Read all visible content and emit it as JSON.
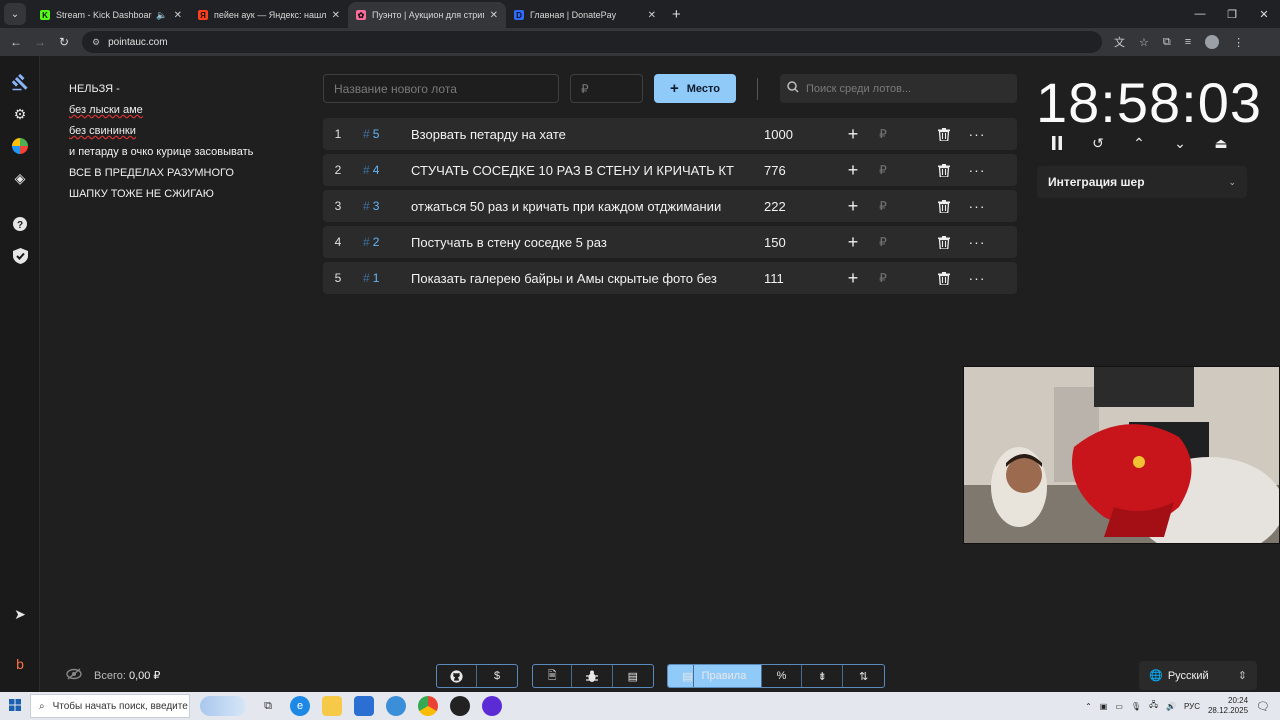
{
  "browser": {
    "tabs": [
      {
        "title": "Stream - Kick Dashboard",
        "icon": "kick-icon",
        "color": "#53fc18",
        "letter": "K",
        "active": false,
        "audio": true
      },
      {
        "title": "пейен аук — Яндекс: нашлось",
        "icon": "yandex-icon",
        "color": "#fc3f1d",
        "letter": "Я",
        "active": false,
        "audio": false
      },
      {
        "title": "Пуэнто | Аукцион для стриме...",
        "icon": "pointauc-icon",
        "color": "#ff6b9a",
        "letter": "✿",
        "active": true,
        "audio": false
      },
      {
        "title": "Главная | DonatePay",
        "icon": "donatepay-icon",
        "color": "#2f6bff",
        "letter": "D",
        "active": false,
        "audio": false
      }
    ],
    "url": "pointauc.com"
  },
  "rules": [
    "НЕЛЬЗЯ -",
    "без лыски аме",
    "без свининки",
    "и петарду в очко курице засовывать",
    "ВСЕ В ПРЕДЕЛАХ РАЗУМНОГО",
    "ШАПКУ ТОЖЕ НЕ СЖИГАЮ"
  ],
  "controls": {
    "lot_placeholder": "Название нового лота",
    "price_placeholder": "₽",
    "place_button": "Место",
    "search_placeholder": "Поиск среди лотов..."
  },
  "lots": [
    {
      "num": "1",
      "fast_id": "5",
      "name": "Взорвать петарду на хате",
      "amount": "1000"
    },
    {
      "num": "2",
      "fast_id": "4",
      "name": "СТУЧАТЬ СОСЕДКЕ 10 РАЗ В СТЕНУ И КРИЧАТЬ КТ",
      "amount": "776"
    },
    {
      "num": "3",
      "fast_id": "3",
      "name": "отжаться 50 раз и кричать при каждом отджимании",
      "amount": "222"
    },
    {
      "num": "4",
      "fast_id": "2",
      "name": "Постучать в стену соседке 5 раз",
      "amount": "150"
    },
    {
      "num": "5",
      "fast_id": "1",
      "name": "Показать галерею байры и Амы скрытые фото без",
      "amount": "111"
    }
  ],
  "lot_hash": "#",
  "rub_symbol": "₽",
  "timer": {
    "time": "18:58:03"
  },
  "integration": {
    "label": "Интеграция шер"
  },
  "footer": {
    "total_label": "Всего:",
    "total_value": "0,00 ₽",
    "rules_button": "Правила",
    "language": "Русский"
  },
  "taskbar": {
    "search_text": "Чтобы начать поиск, введите",
    "lang": "РУС",
    "time": "20:24",
    "date": "28.12.2025"
  },
  "accent_color": "#90caf9"
}
